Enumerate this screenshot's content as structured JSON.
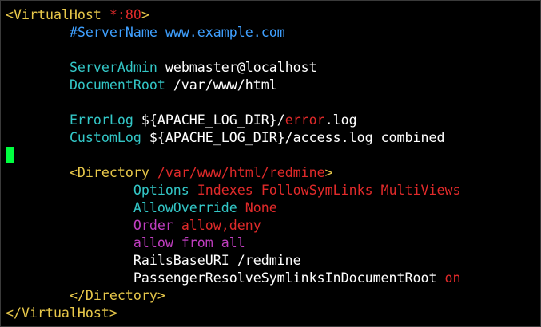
{
  "colors": {
    "background": "#000000",
    "default_text": "#ffffff",
    "tag_yellow": "#e8c84a",
    "cyan_directive": "#33c7c7",
    "comment_blue": "#3fa0ff",
    "red_value": "#e02a2a",
    "magenta_keyword": "#c13ec1",
    "cursor_green": "#00ff40"
  },
  "editor": {
    "cursor_line_index": 8,
    "lines": [
      [
        {
          "text": "<VirtualHost ",
          "color": "#e8c84a"
        },
        {
          "text": "*:80",
          "color": "#e02a2a"
        },
        {
          "text": ">",
          "color": "#e8c84a"
        }
      ],
      [
        {
          "text": "        ",
          "color": "#ffffff"
        },
        {
          "text": "#ServerName www.example.com",
          "color": "#3fa0ff"
        }
      ],
      [],
      [
        {
          "text": "        ",
          "color": "#ffffff"
        },
        {
          "text": "ServerAdmin",
          "color": "#33c7c7"
        },
        {
          "text": " webmaster@localhost",
          "color": "#ffffff"
        }
      ],
      [
        {
          "text": "        ",
          "color": "#ffffff"
        },
        {
          "text": "DocumentRoot",
          "color": "#33c7c7"
        },
        {
          "text": " /var/www/html",
          "color": "#ffffff"
        }
      ],
      [],
      [
        {
          "text": "        ",
          "color": "#ffffff"
        },
        {
          "text": "ErrorLog",
          "color": "#33c7c7"
        },
        {
          "text": " ${APACHE_LOG_DIR}/",
          "color": "#ffffff"
        },
        {
          "text": "error",
          "color": "#e02a2a"
        },
        {
          "text": ".log",
          "color": "#ffffff"
        }
      ],
      [
        {
          "text": "        ",
          "color": "#ffffff"
        },
        {
          "text": "CustomLog",
          "color": "#33c7c7"
        },
        {
          "text": " ${APACHE_LOG_DIR}/access.log combined",
          "color": "#ffffff"
        }
      ],
      [],
      [
        {
          "text": "        ",
          "color": "#ffffff"
        },
        {
          "text": "<Directory ",
          "color": "#e8c84a"
        },
        {
          "text": "/var/www/html/redmine",
          "color": "#e02a2a"
        },
        {
          "text": ">",
          "color": "#e8c84a"
        }
      ],
      [
        {
          "text": "                ",
          "color": "#ffffff"
        },
        {
          "text": "Options",
          "color": "#33c7c7"
        },
        {
          "text": " ",
          "color": "#ffffff"
        },
        {
          "text": "Indexes FollowSymLinks MultiViews",
          "color": "#e02a2a"
        }
      ],
      [
        {
          "text": "                ",
          "color": "#ffffff"
        },
        {
          "text": "AllowOverride",
          "color": "#33c7c7"
        },
        {
          "text": " ",
          "color": "#ffffff"
        },
        {
          "text": "None",
          "color": "#e02a2a"
        }
      ],
      [
        {
          "text": "                ",
          "color": "#ffffff"
        },
        {
          "text": "Order",
          "color": "#c13ec1"
        },
        {
          "text": " ",
          "color": "#ffffff"
        },
        {
          "text": "allow,deny",
          "color": "#e02a2a"
        }
      ],
      [
        {
          "text": "                ",
          "color": "#ffffff"
        },
        {
          "text": "allow from all",
          "color": "#c13ec1"
        }
      ],
      [
        {
          "text": "                ",
          "color": "#ffffff"
        },
        {
          "text": "RailsBaseURI /redmine",
          "color": "#ffffff"
        }
      ],
      [
        {
          "text": "                ",
          "color": "#ffffff"
        },
        {
          "text": "PassengerResolveSymlinksInDocumentRoot ",
          "color": "#ffffff"
        },
        {
          "text": "on",
          "color": "#e02a2a"
        }
      ],
      [
        {
          "text": "        ",
          "color": "#ffffff"
        },
        {
          "text": "</Directory>",
          "color": "#e8c84a"
        }
      ],
      [
        {
          "text": "</VirtualHost>",
          "color": "#e8c84a"
        }
      ]
    ]
  }
}
